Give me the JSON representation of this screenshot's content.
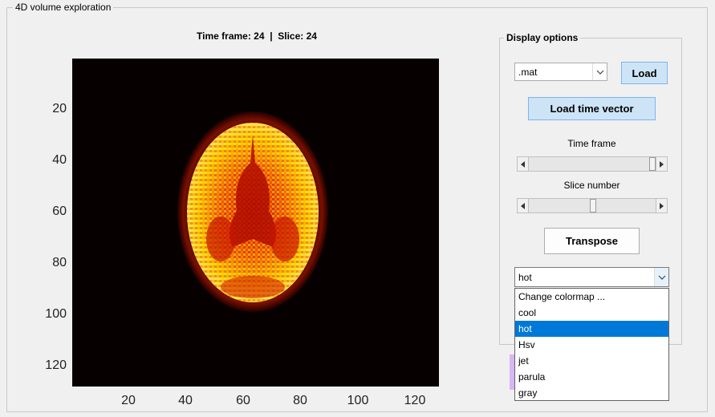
{
  "frame": {
    "title": "4D volume exploration"
  },
  "plot": {
    "title": "Time frame: 24  |  Slice: 24",
    "yticks": [
      "20",
      "40",
      "60",
      "80",
      "100",
      "120"
    ],
    "xticks": [
      "20",
      "40",
      "60",
      "80",
      "100",
      "120"
    ]
  },
  "panel": {
    "title": "Display options",
    "file_type_select": ".mat",
    "load_button": "Load",
    "load_time_vector_button": "Load time vector",
    "time_frame_label": "Time frame",
    "slice_number_label": "Slice number",
    "time_frame_slider_value": 1.0,
    "slice_slider_value": 0.5,
    "transpose_button": "Transpose",
    "colormap_select": "hot",
    "colormap_options": [
      "Change colormap ...",
      "cool",
      "hot",
      "Hsv",
      "jet",
      "parula",
      "gray"
    ],
    "colormap_selected_index": 2
  },
  "icons": {
    "combo_arrow": "chevron-down-icon",
    "slider_left": "triangle-left-icon",
    "slider_right": "triangle-right-icon"
  }
}
